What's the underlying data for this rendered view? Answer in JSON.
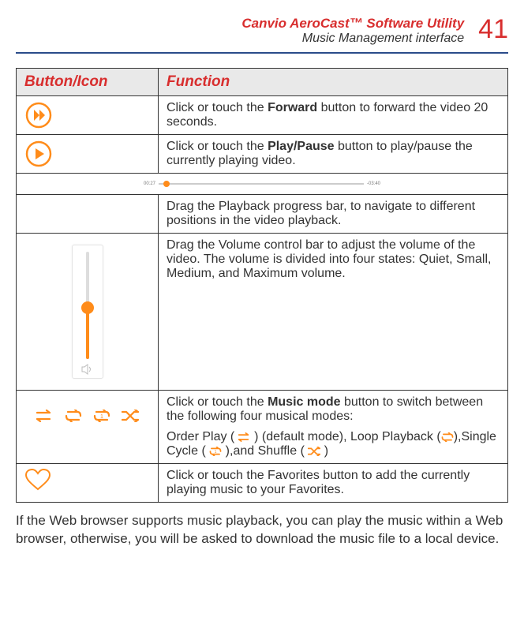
{
  "header": {
    "product": "Canvio AeroCast™ Software Utility",
    "subtitle": "Music Management interface",
    "page": "41"
  },
  "table": {
    "headers": {
      "col1": "Button/Icon",
      "col2": "Function"
    },
    "rows": {
      "forward": {
        "pre": "Click or touch the ",
        "bold": "Forward",
        "post": " button to forward the video 20 seconds."
      },
      "playpause": {
        "pre": "Click or touch the ",
        "bold": "Play/Pause",
        "post": " button to play/pause the currently playing video."
      },
      "progress": {
        "time_left": "00:27",
        "time_right": "-03:40",
        "text": "Drag the Playback progress bar, to navigate to different positions in the video playback."
      },
      "volume": {
        "text": "Drag the Volume control bar to adjust the volume of the video. The volume is divided into four states: Quiet, Small, Medium, and Maximum volume."
      },
      "modes": {
        "line1_pre": "Click or touch the ",
        "line1_bold": "Music mode",
        "line1_post": " button to switch between the following four musical modes:",
        "line2_a": "Order Play ( ",
        "line2_b": " ) (default mode), Loop Playback (",
        "line2_c": "),Single Cycle ( ",
        "line2_d": " ),and Shuffle ( ",
        "line2_e": " )"
      },
      "favorites": {
        "text": "Click or touch the Favorites button to add the currently playing music to your Favorites."
      }
    }
  },
  "footer": "If the Web browser supports music playback, you can play the music within a Web browser, otherwise, you will be asked to download the music file to a local device."
}
